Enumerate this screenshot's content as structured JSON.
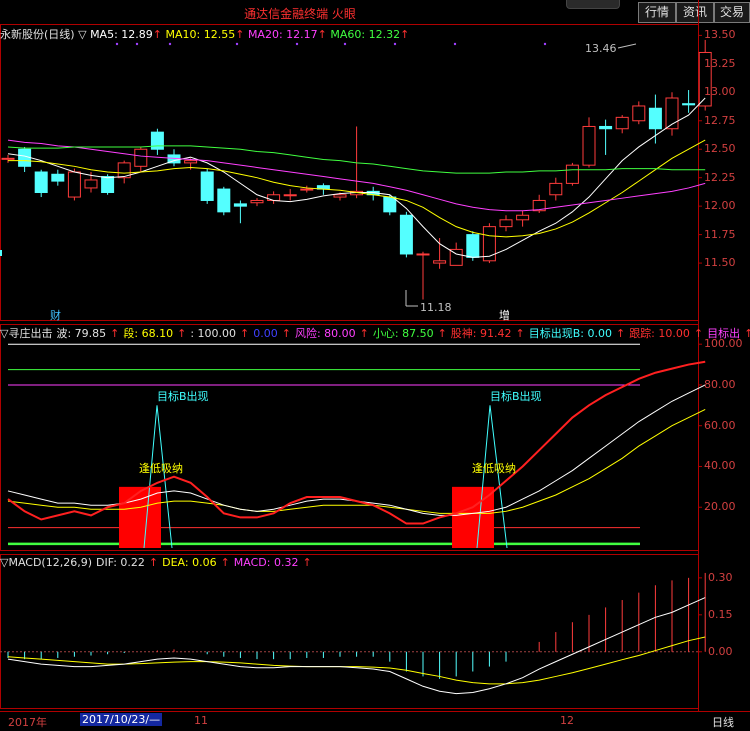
{
  "title": "通达信金融终端  火眼",
  "buttons": [
    "行情",
    "资讯",
    "交易"
  ],
  "price_panel": {
    "legend_name": "永新股份(日线)",
    "legend_marker": "▽",
    "ma": [
      {
        "label": "MA5: 12.89",
        "color": "#ffffff"
      },
      {
        "label": "MA10: 12.55",
        "color": "#ffff00"
      },
      {
        "label": "MA20: 12.17",
        "color": "#ff40ff"
      },
      {
        "label": "MA60: 12.32",
        "color": "#40ff40"
      }
    ],
    "yaxis": [
      "13.50",
      "13.25",
      "13.00",
      "12.75",
      "12.50",
      "12.25",
      "12.00",
      "11.75",
      "11.50"
    ],
    "high_label": "13.46",
    "low_label": "11.18",
    "markers": [
      "财",
      "增"
    ]
  },
  "indicator_panel": {
    "legend": [
      {
        "text": "▽寻庄出击",
        "color": "#e0e0e0"
      },
      {
        "text": "波: 79.85",
        "color": "#e0e0e0"
      },
      {
        "text": "段: 68.10",
        "color": "#ffff00"
      },
      {
        "text": ": 100.00",
        "color": "#e0e0e0"
      },
      {
        "text": "0.00",
        "color": "#4040ff"
      },
      {
        "text": "风险: 80.00",
        "color": "#ff40ff"
      },
      {
        "text": "小心: 87.50",
        "color": "#40ff40"
      },
      {
        "text": "股神: 91.42",
        "color": "#ff3030"
      },
      {
        "text": "目标出现B: 0.00",
        "color": "#40ffff"
      },
      {
        "text": "跟踪: 10.00",
        "color": "#ff3030"
      },
      {
        "text": "目标出",
        "color": "#ff40ff"
      }
    ],
    "yaxis": [
      "100.00",
      "80.00",
      "60.00",
      "40.00",
      "20.00"
    ],
    "target_label": "目标B出现",
    "buy_label": "逢低吸纳"
  },
  "macd_panel": {
    "legend": [
      {
        "text": "▽MACD(12,26,9)",
        "color": "#e0e0e0"
      },
      {
        "text": "DIF: 0.22",
        "color": "#e0e0e0"
      },
      {
        "text": "DEA: 0.06",
        "color": "#ffff00"
      },
      {
        "text": "MACD: 0.32",
        "color": "#ff40ff"
      }
    ],
    "yaxis": [
      "0.30",
      "0.15",
      "0.00"
    ]
  },
  "timeline": {
    "year": "2017年",
    "date": "2017/10/23/—",
    "m11": "11",
    "m12": "12",
    "period": "日线"
  },
  "chart_data": {
    "type": "candlestick",
    "price_ylim": [
      11.0,
      13.6
    ],
    "candles": [
      [
        12.42,
        12.42,
        12.38,
        12.45
      ],
      [
        12.5,
        12.35,
        12.3,
        12.52
      ],
      [
        12.3,
        12.12,
        12.08,
        12.32
      ],
      [
        12.28,
        12.22,
        12.18,
        12.32
      ],
      [
        12.08,
        12.3,
        12.05,
        12.33
      ],
      [
        12.16,
        12.23,
        12.12,
        12.3
      ],
      [
        12.26,
        12.12,
        12.1,
        12.28
      ],
      [
        12.25,
        12.38,
        12.2,
        12.4
      ],
      [
        12.35,
        12.5,
        12.3,
        12.52
      ],
      [
        12.65,
        12.5,
        12.45,
        12.68
      ],
      [
        12.45,
        12.38,
        12.35,
        12.5
      ],
      [
        12.38,
        12.4,
        12.32,
        12.42
      ],
      [
        12.3,
        12.05,
        12.02,
        12.33
      ],
      [
        12.15,
        11.95,
        11.92,
        12.17
      ],
      [
        12.02,
        12.0,
        11.85,
        12.05
      ],
      [
        12.03,
        12.05,
        12.0,
        12.07
      ],
      [
        12.05,
        12.1,
        12.02,
        12.13
      ],
      [
        12.1,
        12.1,
        12.05,
        12.15
      ],
      [
        12.15,
        12.15,
        12.12,
        12.18
      ],
      [
        12.18,
        12.15,
        12.1,
        12.2
      ],
      [
        12.08,
        12.1,
        12.05,
        12.12
      ],
      [
        12.1,
        12.13,
        12.07,
        12.7
      ],
      [
        12.13,
        12.1,
        12.05,
        12.17
      ],
      [
        12.08,
        11.95,
        11.92,
        12.1
      ],
      [
        11.92,
        11.58,
        11.55,
        11.95
      ],
      [
        11.58,
        11.58,
        11.18,
        11.6
      ],
      [
        11.5,
        11.52,
        11.45,
        11.72
      ],
      [
        11.48,
        11.62,
        11.48,
        11.68
      ],
      [
        11.75,
        11.55,
        11.52,
        11.78
      ],
      [
        11.52,
        11.82,
        11.5,
        11.85
      ],
      [
        11.82,
        11.88,
        11.78,
        11.92
      ],
      [
        11.88,
        11.92,
        11.82,
        11.96
      ],
      [
        11.96,
        12.05,
        11.94,
        12.1
      ],
      [
        12.1,
        12.2,
        12.05,
        12.25
      ],
      [
        12.2,
        12.36,
        12.18,
        12.38
      ],
      [
        12.36,
        12.7,
        12.34,
        12.78
      ],
      [
        12.7,
        12.68,
        12.45,
        12.76
      ],
      [
        12.68,
        12.78,
        12.64,
        12.8
      ],
      [
        12.75,
        12.88,
        12.72,
        12.92
      ],
      [
        12.86,
        12.68,
        12.55,
        12.98
      ],
      [
        12.68,
        12.95,
        12.62,
        13.0
      ],
      [
        12.9,
        12.89,
        12.82,
        13.02
      ],
      [
        12.88,
        13.35,
        12.84,
        13.46
      ]
    ],
    "ma5": [
      12.46,
      12.44,
      12.4,
      12.35,
      12.3,
      12.27,
      12.25,
      12.26,
      12.3,
      12.35,
      12.4,
      12.43,
      12.38,
      12.3,
      12.2,
      12.1,
      12.05,
      12.04,
      12.06,
      12.09,
      12.11,
      12.12,
      12.12,
      12.1,
      11.98,
      11.82,
      11.67,
      11.58,
      11.55,
      11.56,
      11.62,
      11.7,
      11.78,
      11.85,
      11.95,
      12.08,
      12.24,
      12.4,
      12.52,
      12.62,
      12.72,
      12.8,
      12.95
    ],
    "ma10": [
      12.4,
      12.4,
      12.39,
      12.37,
      12.35,
      12.32,
      12.3,
      12.29,
      12.3,
      12.31,
      12.33,
      12.34,
      12.33,
      12.31,
      12.28,
      12.25,
      12.21,
      12.18,
      12.16,
      12.15,
      12.14,
      12.12,
      12.1,
      12.08,
      12.05,
      11.99,
      11.9,
      11.82,
      11.77,
      11.74,
      11.73,
      11.74,
      11.76,
      11.8,
      11.86,
      11.94,
      12.03,
      12.12,
      12.22,
      12.32,
      12.42,
      12.5,
      12.58
    ],
    "ma20": [
      12.58,
      12.56,
      12.55,
      12.53,
      12.52,
      12.5,
      12.48,
      12.46,
      12.44,
      12.43,
      12.42,
      12.41,
      12.4,
      12.38,
      12.36,
      12.34,
      12.32,
      12.3,
      12.28,
      12.26,
      12.24,
      12.22,
      12.2,
      12.17,
      12.14,
      12.1,
      12.06,
      12.02,
      11.99,
      11.97,
      11.96,
      11.96,
      11.97,
      11.99,
      12.01,
      12.03,
      12.05,
      12.07,
      12.09,
      12.11,
      12.13,
      12.16,
      12.2
    ],
    "ma60": [
      12.52,
      12.51,
      12.51,
      12.51,
      12.52,
      12.52,
      12.52,
      12.52,
      12.52,
      12.53,
      12.53,
      12.53,
      12.52,
      12.51,
      12.5,
      12.48,
      12.47,
      12.45,
      12.43,
      12.41,
      12.4,
      12.38,
      12.37,
      12.35,
      12.33,
      12.31,
      12.3,
      12.29,
      12.29,
      12.29,
      12.3,
      12.3,
      12.31,
      12.31,
      12.32,
      12.32,
      12.32,
      12.33,
      12.33,
      12.33,
      12.32,
      12.32,
      12.32
    ],
    "ind_ylim": [
      0,
      105
    ],
    "bo": [
      28,
      26,
      24,
      22,
      22,
      21,
      21,
      22,
      24,
      27,
      28,
      27,
      24,
      21,
      19,
      18,
      19,
      21,
      23,
      24,
      24,
      23,
      22,
      21,
      19,
      17,
      16,
      16,
      17,
      18,
      20,
      24,
      28,
      33,
      38,
      44,
      50,
      56,
      62,
      67,
      72,
      76,
      80
    ],
    "duan": [
      23,
      22,
      21,
      20,
      20,
      19,
      19,
      19,
      20,
      22,
      23,
      23,
      22,
      21,
      19,
      18,
      18,
      19,
      20,
      21,
      21,
      21,
      21,
      20,
      19,
      18,
      17,
      17,
      17,
      17,
      18,
      20,
      23,
      26,
      30,
      34,
      39,
      44,
      50,
      55,
      60,
      64,
      68
    ],
    "gushen": [
      24,
      18,
      14,
      16,
      18,
      16,
      20,
      22,
      28,
      32,
      35,
      32,
      25,
      17,
      15,
      15,
      17,
      22,
      25,
      25,
      25,
      23,
      21,
      17,
      12,
      12,
      15,
      17,
      20,
      26,
      33,
      40,
      48,
      56,
      64,
      70,
      75,
      79,
      83,
      86,
      88,
      90,
      91.4
    ],
    "lines": [
      100,
      87.5,
      80,
      10,
      2
    ],
    "macd_ylim": [
      -0.22,
      0.34
    ],
    "macd_bars": [
      -0.025,
      -0.03,
      -0.03,
      -0.025,
      -0.02,
      -0.015,
      -0.01,
      -0.005,
      0.0,
      0.005,
      0.01,
      0.0,
      -0.01,
      -0.02,
      -0.025,
      -0.03,
      -0.03,
      -0.03,
      -0.025,
      -0.025,
      -0.02,
      -0.02,
      -0.02,
      -0.04,
      -0.08,
      -0.1,
      -0.11,
      -0.1,
      -0.08,
      -0.06,
      -0.04,
      0.0,
      0.04,
      0.08,
      0.12,
      0.15,
      0.18,
      0.21,
      0.24,
      0.27,
      0.29,
      0.3,
      0.32
    ],
    "dif": [
      -0.03,
      -0.04,
      -0.05,
      -0.055,
      -0.06,
      -0.06,
      -0.055,
      -0.05,
      -0.04,
      -0.03,
      -0.025,
      -0.03,
      -0.04,
      -0.05,
      -0.06,
      -0.065,
      -0.065,
      -0.06,
      -0.06,
      -0.06,
      -0.06,
      -0.065,
      -0.07,
      -0.08,
      -0.11,
      -0.14,
      -0.16,
      -0.17,
      -0.165,
      -0.15,
      -0.13,
      -0.105,
      -0.07,
      -0.04,
      -0.01,
      0.02,
      0.05,
      0.08,
      0.11,
      0.14,
      0.16,
      0.19,
      0.22
    ],
    "dea": [
      -0.02,
      -0.025,
      -0.03,
      -0.035,
      -0.04,
      -0.045,
      -0.05,
      -0.05,
      -0.048,
      -0.045,
      -0.042,
      -0.04,
      -0.04,
      -0.042,
      -0.045,
      -0.05,
      -0.055,
      -0.058,
      -0.06,
      -0.06,
      -0.06,
      -0.06,
      -0.062,
      -0.066,
      -0.075,
      -0.088,
      -0.1,
      -0.115,
      -0.125,
      -0.13,
      -0.13,
      -0.125,
      -0.115,
      -0.1,
      -0.085,
      -0.068,
      -0.05,
      -0.032,
      -0.015,
      0.005,
      0.025,
      0.045,
      0.06
    ]
  }
}
